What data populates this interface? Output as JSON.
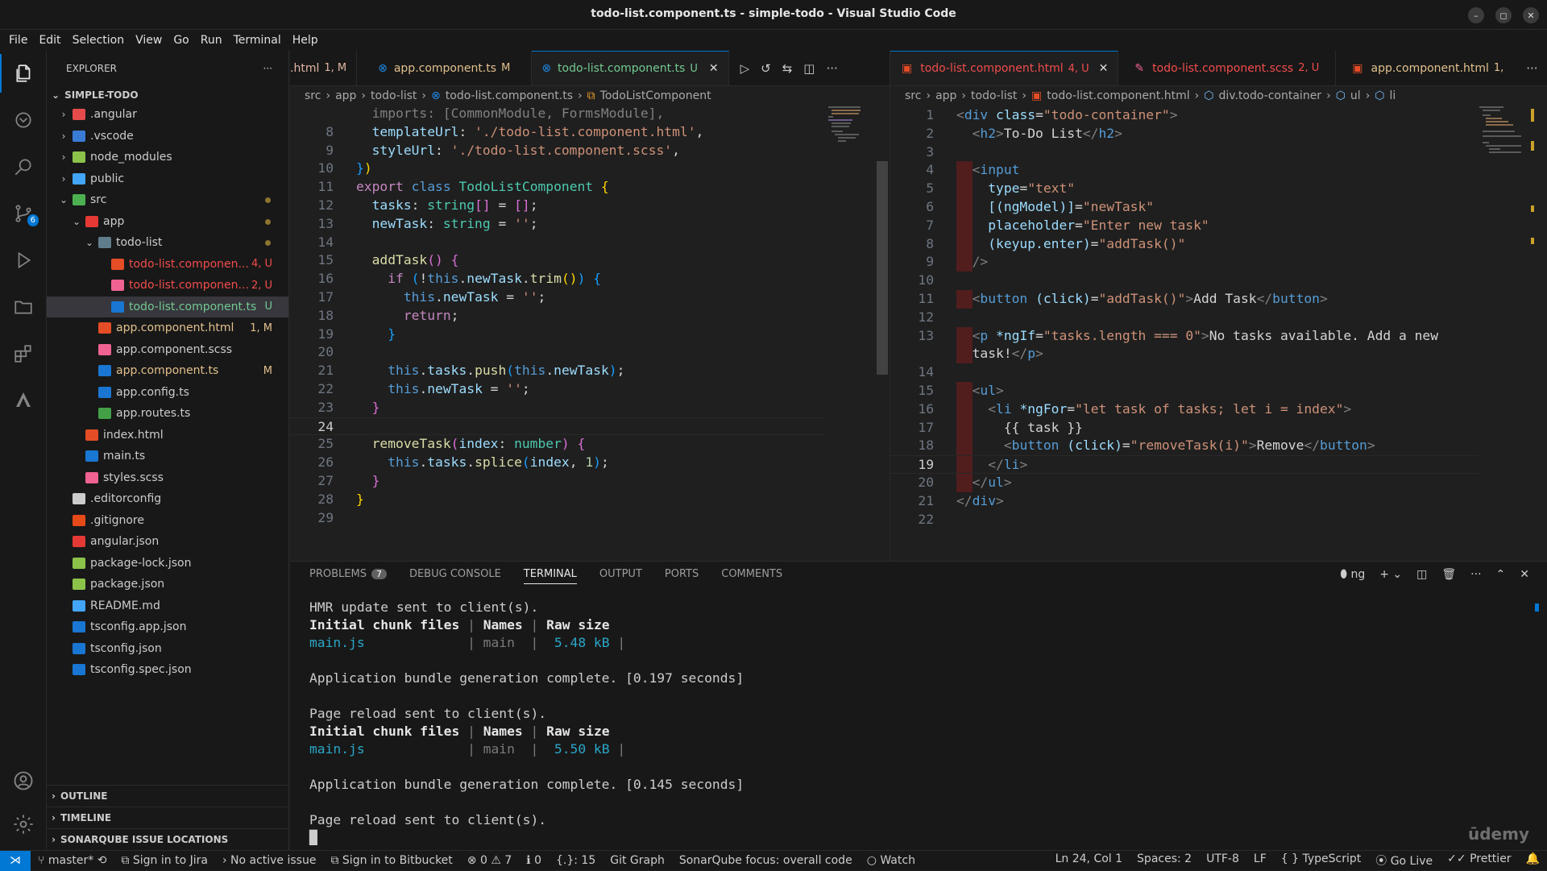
{
  "window": {
    "title": "todo-list.component.ts - simple-todo - Visual Studio Code"
  },
  "menu": [
    "File",
    "Edit",
    "Selection",
    "View",
    "Go",
    "Run",
    "Terminal",
    "Help"
  ],
  "activity": {
    "scm_badge": "6"
  },
  "explorer": {
    "header": "EXPLORER",
    "root": "SIMPLE-TODO",
    "items": [
      {
        "label": ".angular",
        "status": "",
        "color": "#e54b4b",
        "indent": 0,
        "chev": ">"
      },
      {
        "label": ".vscode",
        "status": "",
        "color": "#3a7bd5",
        "indent": 0,
        "chev": ">"
      },
      {
        "label": "node_modules",
        "status": "",
        "color": "#8bc34a",
        "indent": 0,
        "chev": ">"
      },
      {
        "label": "public",
        "status": "",
        "color": "#42a5f5",
        "indent": 0,
        "chev": ">"
      },
      {
        "label": "src",
        "status": "",
        "color": "#4caf50",
        "indent": 0,
        "chev": "v",
        "dot": true
      },
      {
        "label": "app",
        "status": "",
        "color": "#e53935",
        "indent": 1,
        "chev": "v",
        "dot": true
      },
      {
        "label": "todo-list",
        "status": "",
        "color": "#607d8b",
        "indent": 2,
        "chev": "v",
        "dot": true
      },
      {
        "label": "todo-list.componen...",
        "status": "4, U",
        "color": "#e44d26",
        "indent": 3,
        "chev": ""
      },
      {
        "label": "todo-list.componen...",
        "status": "2, U",
        "color": "#f06292",
        "indent": 3,
        "chev": ""
      },
      {
        "label": "todo-list.component.ts",
        "status": "U",
        "color": "#1976d2",
        "indent": 3,
        "chev": "",
        "selected": true
      },
      {
        "label": "app.component.html",
        "status": "1, M",
        "color": "#e44d26",
        "indent": 2,
        "chev": ""
      },
      {
        "label": "app.component.scss",
        "status": "",
        "color": "#f06292",
        "indent": 2,
        "chev": ""
      },
      {
        "label": "app.component.ts",
        "status": "M",
        "color": "#1976d2",
        "indent": 2,
        "chev": ""
      },
      {
        "label": "app.config.ts",
        "status": "",
        "color": "#1976d2",
        "indent": 2,
        "chev": ""
      },
      {
        "label": "app.routes.ts",
        "status": "",
        "color": "#43a047",
        "indent": 2,
        "chev": ""
      },
      {
        "label": "index.html",
        "status": "",
        "color": "#e44d26",
        "indent": 1,
        "chev": ""
      },
      {
        "label": "main.ts",
        "status": "",
        "color": "#1976d2",
        "indent": 1,
        "chev": ""
      },
      {
        "label": "styles.scss",
        "status": "",
        "color": "#f06292",
        "indent": 1,
        "chev": ""
      },
      {
        "label": ".editorconfig",
        "status": "",
        "color": "#cccccc",
        "indent": 0,
        "chev": ""
      },
      {
        "label": ".gitignore",
        "status": "",
        "color": "#e64a19",
        "indent": 0,
        "chev": ""
      },
      {
        "label": "angular.json",
        "status": "",
        "color": "#e53935",
        "indent": 0,
        "chev": ""
      },
      {
        "label": "package-lock.json",
        "status": "",
        "color": "#8bc34a",
        "indent": 0,
        "chev": ""
      },
      {
        "label": "package.json",
        "status": "",
        "color": "#8bc34a",
        "indent": 0,
        "chev": ""
      },
      {
        "label": "README.md",
        "status": "",
        "color": "#42a5f5",
        "indent": 0,
        "chev": ""
      },
      {
        "label": "tsconfig.app.json",
        "status": "",
        "color": "#1976d2",
        "indent": 0,
        "chev": ""
      },
      {
        "label": "tsconfig.json",
        "status": "",
        "color": "#1976d2",
        "indent": 0,
        "chev": ""
      },
      {
        "label": "tsconfig.spec.json",
        "status": "",
        "color": "#1976d2",
        "indent": 0,
        "chev": ""
      }
    ],
    "sections": [
      "OUTLINE",
      "TIMELINE",
      "SONARQUBE ISSUE LOCATIONS"
    ]
  },
  "left_tabs": [
    {
      "label": ".html",
      "badge": "1, M",
      "color": "#e2b5a3"
    },
    {
      "label": "app.component.ts",
      "badge": "M",
      "color": "#e2c08d"
    },
    {
      "label": "todo-list.component.ts",
      "badge": "U",
      "color": "#73c991",
      "active": true
    }
  ],
  "left_crumbs": [
    "src",
    "app",
    "todo-list",
    "todo-list.component.ts",
    "TodoListComponent"
  ],
  "right_tabs": [
    {
      "label": "todo-list.component.html",
      "badge": "4, U",
      "color": "#f14c4c",
      "active": true
    },
    {
      "label": "todo-list.component.scss",
      "badge": "2, U",
      "color": "#f14c4c"
    },
    {
      "label": "app.component.html",
      "badge": "1,",
      "color": "#e2c08d"
    }
  ],
  "right_crumbs": [
    "src",
    "app",
    "todo-list",
    "todo-list.component.html",
    "div.todo-container",
    "ul",
    "li"
  ],
  "ts_code": [
    {
      "n": "",
      "html": "<span class='g'>  imports: [CommonModule, FormsModule],</span>"
    },
    {
      "n": "8",
      "html": "  <span class='p'>templateUrl</span>: <span class='s'>'./todo-list.component.html'</span>,"
    },
    {
      "n": "9",
      "html": "  <span class='p'>styleUrl</span>: <span class='s'>'./todo-list.component.scss'</span>,"
    },
    {
      "n": "10",
      "html": "<span class='br3'>}</span><span class='br'>)</span>"
    },
    {
      "n": "11",
      "html": "<span class='kw'>export</span> <span class='k'>class</span> <span class='t'>TodoListComponent</span> <span class='br'>{</span>"
    },
    {
      "n": "12",
      "html": "  <span class='p'>tasks</span>: <span class='t'>string</span><span class='br2'>[]</span> = <span class='br2'>[]</span>;"
    },
    {
      "n": "13",
      "html": "  <span class='p'>newTask</span>: <span class='t'>string</span> = <span class='s'>''</span>;"
    },
    {
      "n": "14",
      "html": ""
    },
    {
      "n": "15",
      "html": "  <span class='f'>addTask</span><span class='br2'>()</span> <span class='br2'>{</span>"
    },
    {
      "n": "16",
      "html": "    <span class='kw'>if</span> <span class='br3'>(</span>!<span class='k'>this</span>.<span class='p'>newTask</span>.<span class='f'>trim</span><span class='br'>()</span><span class='br3'>)</span> <span class='br3'>{</span>"
    },
    {
      "n": "17",
      "html": "      <span class='k'>this</span>.<span class='p'>newTask</span> = <span class='s'>''</span>;"
    },
    {
      "n": "18",
      "html": "      <span class='kw'>return</span>;"
    },
    {
      "n": "19",
      "html": "    <span class='br3'>}</span>"
    },
    {
      "n": "20",
      "html": ""
    },
    {
      "n": "21",
      "html": "    <span class='k'>this</span>.<span class='p'>tasks</span>.<span class='f'>push</span><span class='br3'>(</span><span class='k'>this</span>.<span class='p'>newTask</span><span class='br3'>)</span>;"
    },
    {
      "n": "22",
      "html": "    <span class='k'>this</span>.<span class='p'>newTask</span> = <span class='s'>''</span>;"
    },
    {
      "n": "23",
      "html": "  <span class='br2'>}</span>"
    },
    {
      "n": "24",
      "html": "",
      "cur": true
    },
    {
      "n": "25",
      "html": "  <span class='f'>removeTask</span><span class='br2'>(</span><span class='p'>index</span>: <span class='t'>number</span><span class='br2'>)</span> <span class='br2'>{</span>"
    },
    {
      "n": "26",
      "html": "    <span class='k'>this</span>.<span class='p'>tasks</span>.<span class='f'>splice</span><span class='br3'>(</span><span class='p'>index</span>, <span class='n'>1</span><span class='br3'>)</span>;"
    },
    {
      "n": "27",
      "html": "  <span class='br2'>}</span>"
    },
    {
      "n": "28",
      "html": "<span class='br'>}</span>"
    },
    {
      "n": "29",
      "html": ""
    }
  ],
  "html_code": [
    {
      "n": "1",
      "html": "<span class='g'>&lt;</span><span class='tag'>div</span> <span class='attr'>class</span>=<span class='s'>\"todo-container\"</span><span class='g'>&gt;</span>"
    },
    {
      "n": "2",
      "html": "  <span class='g'>&lt;</span><span class='tag'>h2</span><span class='g'>&gt;</span>To-Do List<span class='g'>&lt;/</span><span class='tag'>h2</span><span class='g'>&gt;</span>"
    },
    {
      "n": "3",
      "html": ""
    },
    {
      "n": "4",
      "html": "  <span class='g'>&lt;</span><span class='tag'>input</span>"
    },
    {
      "n": "5",
      "html": "    <span class='attr'>type</span>=<span class='s'>\"text\"</span>"
    },
    {
      "n": "6",
      "html": "    <span class='attr'>[(ngModel)]</span>=<span class='s'>\"newTask\"</span>"
    },
    {
      "n": "7",
      "html": "    <span class='attr'>placeholder</span>=<span class='s'>\"Enter new task\"</span>"
    },
    {
      "n": "8",
      "html": "    <span class='attr'>(keyup.enter)</span>=<span class='s'>\"addTask()\"</span>"
    },
    {
      "n": "9",
      "html": "  <span class='g'>/&gt;</span>"
    },
    {
      "n": "10",
      "html": ""
    },
    {
      "n": "11",
      "html": "  <span class='g'>&lt;</span><span class='tag'>button</span> <span class='attr'>(click)</span>=<span class='s'>\"addTask()\"</span><span class='g'>&gt;</span>Add Task<span class='g'>&lt;/</span><span class='tag'>button</span><span class='g'>&gt;</span>"
    },
    {
      "n": "12",
      "html": ""
    },
    {
      "n": "13",
      "html": "  <span class='g'>&lt;</span><span class='tag'>p</span> <span class='attr'>*ngIf</span>=<span class='s'>\"tasks.length === 0\"</span><span class='g'>&gt;</span>No tasks available. Add a new"
    },
    {
      "n": "",
      "html": "  task!<span class='g'>&lt;/</span><span class='tag'>p</span><span class='g'>&gt;</span>"
    },
    {
      "n": "14",
      "html": ""
    },
    {
      "n": "15",
      "html": "  <span class='g'>&lt;</span><span class='tag'>ul</span><span class='g'>&gt;</span>"
    },
    {
      "n": "16",
      "html": "    <span class='g'>&lt;</span><span class='tag'>li</span> <span class='attr'>*ngFor</span>=<span class='s'>\"let task of tasks; let i = index\"</span><span class='g'>&gt;</span>"
    },
    {
      "n": "17",
      "html": "      {{ task }}"
    },
    {
      "n": "18",
      "html": "      <span class='g'>&lt;</span><span class='tag'>button</span> <span class='attr'>(click)</span>=<span class='s'>\"removeTask(i)\"</span><span class='g'>&gt;</span>Remove<span class='g'>&lt;/</span><span class='tag'>button</span><span class='g'>&gt;</span>"
    },
    {
      "n": "19",
      "html": "    <span class='g'>&lt;/</span><span class='tag'>li</span><span class='g'>&gt;</span>",
      "cur": true
    },
    {
      "n": "20",
      "html": "  <span class='g'>&lt;/</span><span class='tag'>ul</span><span class='g'>&gt;</span>"
    },
    {
      "n": "21",
      "html": "<span class='g'>&lt;/</span><span class='tag'>div</span><span class='g'>&gt;</span>"
    },
    {
      "n": "22",
      "html": ""
    }
  ],
  "panel": {
    "tabs": [
      "PROBLEMS",
      "DEBUG CONSOLE",
      "TERMINAL",
      "OUTPUT",
      "PORTS",
      "COMMENTS"
    ],
    "problems_count": "7",
    "active": "TERMINAL",
    "shell": "ng"
  },
  "terminal_html": "HMR update sent to client(s).\n<span class='b'>Initial chunk files</span> <span class='d'>|</span> <span class='b'>Names</span> <span class='d'>|</span> <span class='b'>Raw size</span>\n<span class='c'>main.js</span>             <span class='d'>| main  |</span>  <span class='c'>5.48 kB</span> <span class='d'>|</span>\n\nApplication bundle generation complete. [0.197 seconds]\n\nPage reload sent to client(s).\n<span class='b'>Initial chunk files</span> <span class='d'>|</span> <span class='b'>Names</span> <span class='d'>|</span> <span class='b'>Raw size</span>\n<span class='c'>main.js</span>             <span class='d'>| main  |</span>  <span class='c'>5.50 kB</span> <span class='d'>|</span>\n\nApplication bundle generation complete. [0.145 seconds]\n\nPage reload sent to client(s).\n█",
  "status": {
    "branch": "master*",
    "jira": "Sign in to Jira",
    "issue": "No active issue",
    "bitbucket": "Sign in to Bitbucket",
    "errors": "0",
    "warnings": "7",
    "ports": "0",
    "selection": "{.}: 15",
    "gitgraph": "Git Graph",
    "sonar": "SonarQube focus: overall code",
    "watch": "Watch",
    "cursor": "Ln 24, Col 1",
    "spaces": "Spaces: 2",
    "encoding": "UTF-8",
    "eol": "LF",
    "language": "TypeScript",
    "golive": "Go Live",
    "prettier": "Prettier"
  },
  "watermark": "ūdemy"
}
